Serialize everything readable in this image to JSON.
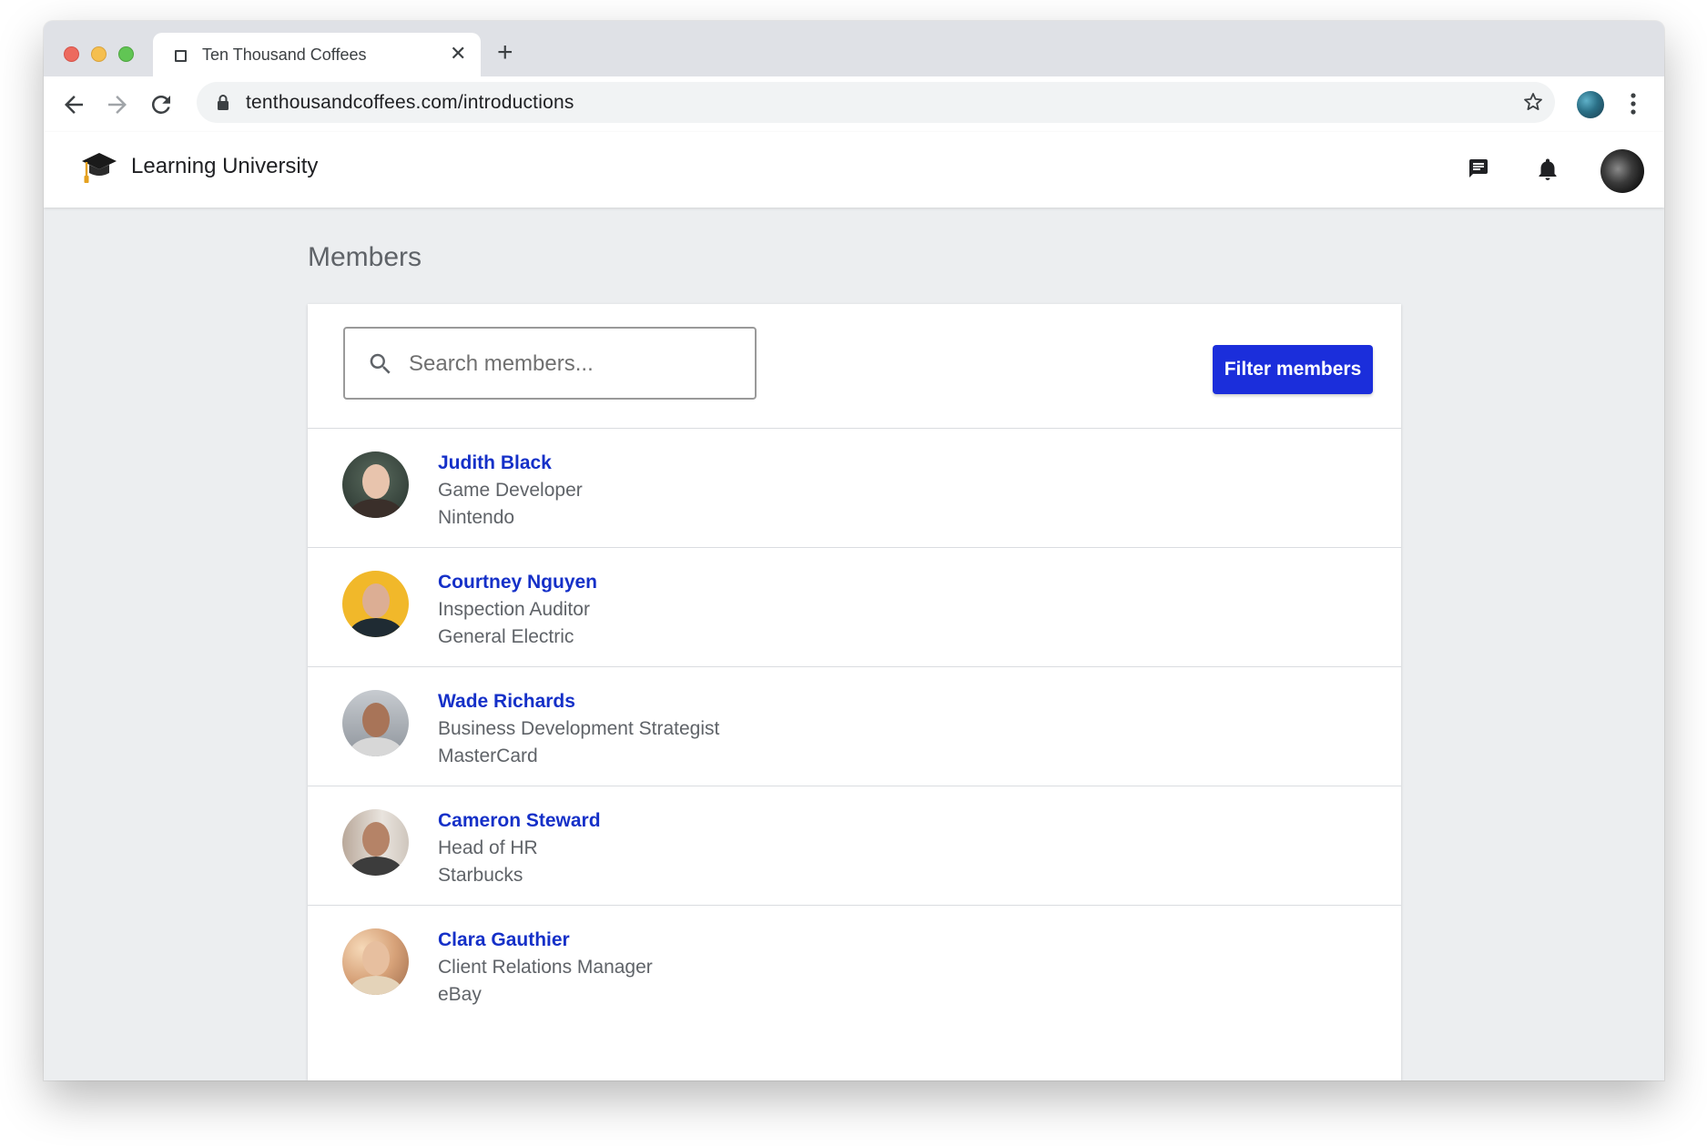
{
  "browser": {
    "tab_title": "Ten Thousand Coffees",
    "url": "tenthousandcoffees.com/introductions"
  },
  "app": {
    "org_name": "Learning University"
  },
  "page": {
    "title": "Members"
  },
  "search": {
    "placeholder": "Search members...",
    "value": ""
  },
  "filter": {
    "label": "Filter members"
  },
  "members": [
    {
      "name": "Judith Black",
      "title": "Game Developer",
      "company": "Nintendo"
    },
    {
      "name": "Courtney Nguyen",
      "title": "Inspection Auditor",
      "company": "General Electric"
    },
    {
      "name": "Wade Richards",
      "title": "Business Development Strategist",
      "company": "MasterCard"
    },
    {
      "name": "Cameron Steward",
      "title": "Head of HR",
      "company": "Starbucks"
    },
    {
      "name": "Clara Gauthier",
      "title": "Client Relations Manager",
      "company": "eBay"
    }
  ],
  "colors": {
    "accent": "#1b2edb",
    "link": "#1530c8",
    "background": "#eceef0"
  },
  "icons": {
    "logo": "graduation-cap-icon",
    "messages": "chat-icon",
    "notifications": "bell-icon",
    "search": "search-icon"
  }
}
